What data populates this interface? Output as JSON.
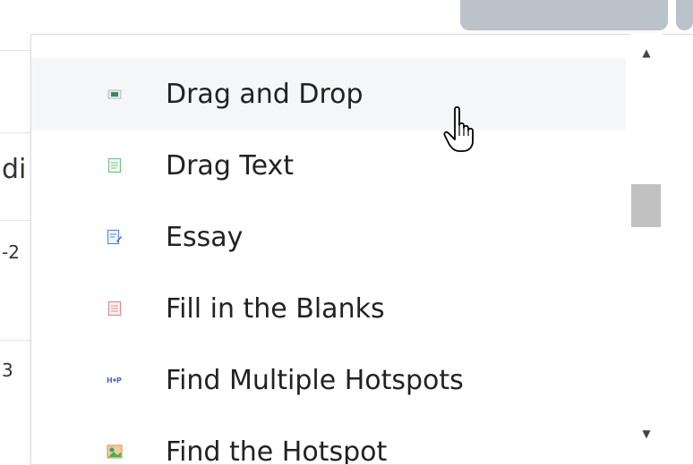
{
  "background": {
    "row_fragments": [
      "di",
      "-2",
      "3"
    ]
  },
  "dropdown": {
    "items": [
      {
        "label": "Drag and Drop",
        "icon": "drag-and-drop-icon"
      },
      {
        "label": "Drag Text",
        "icon": "drag-text-icon"
      },
      {
        "label": "Essay",
        "icon": "essay-icon"
      },
      {
        "label": "Fill in the Blanks",
        "icon": "fill-in-the-blanks-icon"
      },
      {
        "label": "Find Multiple Hotspots",
        "icon": "find-multiple-hotspots-icon"
      },
      {
        "label": "Find the Hotspot",
        "icon": "find-the-hotspot-icon"
      }
    ],
    "hovered_index": 0
  },
  "scrollbar": {
    "up_arrow": "▲",
    "down_arrow": "▼"
  }
}
